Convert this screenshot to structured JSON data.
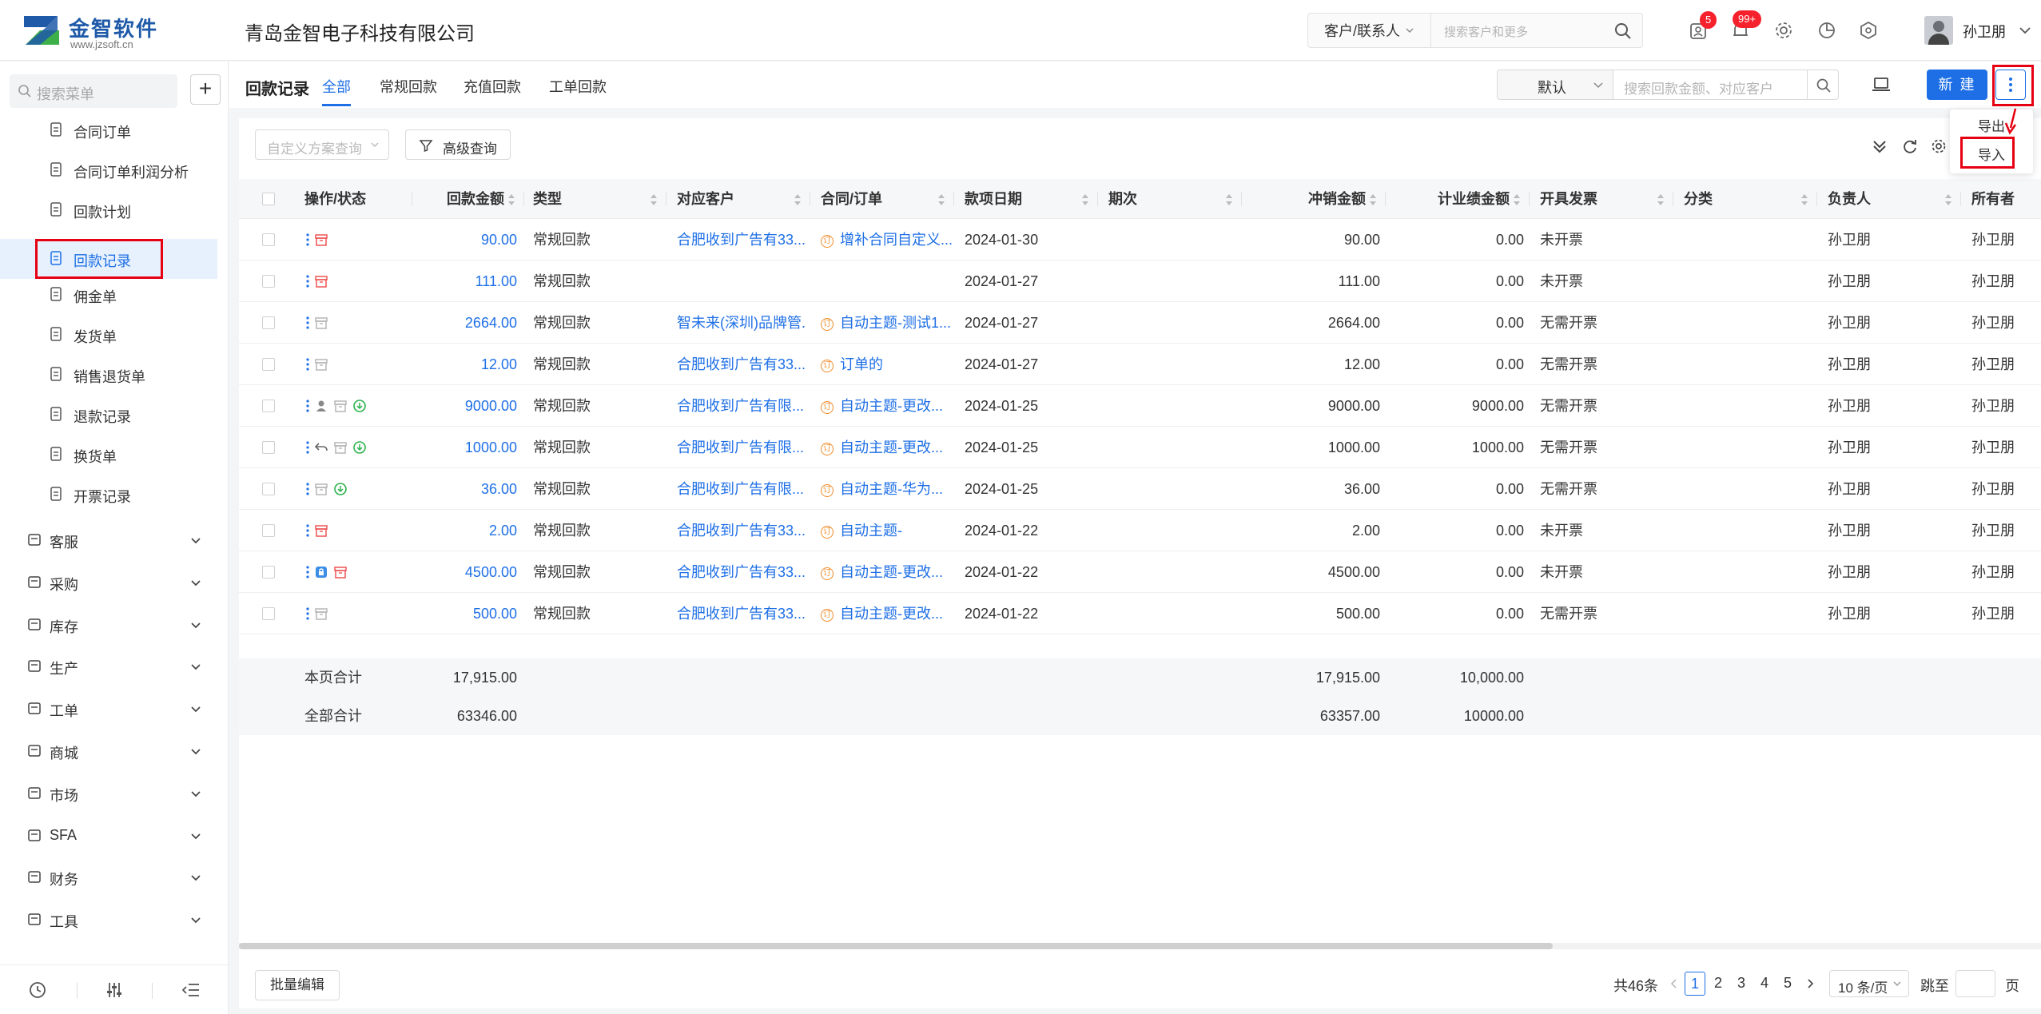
{
  "header": {
    "brand": "金智软件",
    "brand_url": "www.jzsoft.cn",
    "company": "青岛金智电子科技有限公司",
    "search_scope": "客户/联系人",
    "search_placeholder": "搜索客户和更多",
    "todo_badge": "5",
    "notice_badge": "99+",
    "user_name": "孙卫朋"
  },
  "sidebar": {
    "search_placeholder": "搜索菜单",
    "add_label": "+",
    "sub_items": [
      {
        "label": "合同订单",
        "icon": "contract-icon"
      },
      {
        "label": "合同订单利润分析",
        "icon": "analysis-icon"
      },
      {
        "label": "回款计划",
        "icon": "plan-icon"
      },
      {
        "label": "回款记录",
        "icon": "record-icon",
        "active": true
      },
      {
        "label": "佣金单",
        "icon": "commission-icon"
      },
      {
        "label": "发货单",
        "icon": "delivery-icon"
      },
      {
        "label": "销售退货单",
        "icon": "return-icon"
      },
      {
        "label": "退款记录",
        "icon": "refund-icon"
      },
      {
        "label": "换货单",
        "icon": "exchange-icon"
      },
      {
        "label": "开票记录",
        "icon": "invoice-icon"
      }
    ],
    "groups": [
      {
        "label": "客服",
        "icon": "service-icon"
      },
      {
        "label": "采购",
        "icon": "purchase-icon"
      },
      {
        "label": "库存",
        "icon": "warehouse-icon"
      },
      {
        "label": "生产",
        "icon": "production-icon"
      },
      {
        "label": "工单",
        "icon": "workorder-icon"
      },
      {
        "label": "商城",
        "icon": "mall-icon"
      },
      {
        "label": "市场",
        "icon": "market-icon"
      },
      {
        "label": "SFA",
        "icon": "sfa-icon"
      },
      {
        "label": "财务",
        "icon": "finance-icon"
      },
      {
        "label": "工具",
        "icon": "tools-icon"
      }
    ]
  },
  "toolbar": {
    "page_title": "回款记录",
    "tabs": [
      "全部",
      "常规回款",
      "充值回款",
      "工单回款"
    ],
    "active_tab": "全部",
    "view_select": "默认",
    "search_placeholder": "搜索回款金额、对应客户",
    "new_label": "新 建",
    "menu_items": [
      "导出",
      "导入"
    ]
  },
  "filters": {
    "scheme_placeholder": "自定义方案查询",
    "advanced_label": "高级查询"
  },
  "table": {
    "columns": [
      "操作/状态",
      "回款金额",
      "类型",
      "对应客户",
      "合同/订单",
      "款项日期",
      "期次",
      "冲销金额",
      "计业绩金额",
      "开具发票",
      "分类",
      "负责人",
      "所有者"
    ],
    "rows": [
      {
        "amount": "90.00",
        "type": "常规回款",
        "customer": "合肥收到广告有33...",
        "order": "增补合同自定义...",
        "date": "2024-01-30",
        "writeoff": "90.00",
        "perf": "0.00",
        "invoice": "未开票",
        "owner": "孙卫朋",
        "holder": "孙卫朋"
      },
      {
        "amount": "111.00",
        "type": "常规回款",
        "customer": "",
        "order": "",
        "date": "2024-01-27",
        "writeoff": "111.00",
        "perf": "0.00",
        "invoice": "未开票",
        "owner": "孙卫朋",
        "holder": "孙卫朋"
      },
      {
        "amount": "2664.00",
        "type": "常规回款",
        "customer": "智未来(深圳)品牌管...",
        "order": "自动主题-测试1...",
        "date": "2024-01-27",
        "writeoff": "2664.00",
        "perf": "0.00",
        "invoice": "无需开票",
        "owner": "孙卫朋",
        "holder": "孙卫朋"
      },
      {
        "amount": "12.00",
        "type": "常规回款",
        "customer": "合肥收到广告有33...",
        "order": "订单的",
        "date": "2024-01-27",
        "writeoff": "12.00",
        "perf": "0.00",
        "invoice": "无需开票",
        "owner": "孙卫朋",
        "holder": "孙卫朋"
      },
      {
        "amount": "9000.00",
        "type": "常规回款",
        "customer": "合肥收到广告有限...",
        "order": "自动主题-更改...",
        "date": "2024-01-25",
        "writeoff": "9000.00",
        "perf": "9000.00",
        "invoice": "无需开票",
        "owner": "孙卫朋",
        "holder": "孙卫朋"
      },
      {
        "amount": "1000.00",
        "type": "常规回款",
        "customer": "合肥收到广告有限...",
        "order": "自动主题-更改...",
        "date": "2024-01-25",
        "writeoff": "1000.00",
        "perf": "1000.00",
        "invoice": "无需开票",
        "owner": "孙卫朋",
        "holder": "孙卫朋"
      },
      {
        "amount": "36.00",
        "type": "常规回款",
        "customer": "合肥收到广告有限...",
        "order": "自动主题-华为...",
        "date": "2024-01-25",
        "writeoff": "36.00",
        "perf": "0.00",
        "invoice": "无需开票",
        "owner": "孙卫朋",
        "holder": "孙卫朋"
      },
      {
        "amount": "2.00",
        "type": "常规回款",
        "customer": "合肥收到广告有33...",
        "order": "自动主题-",
        "date": "2024-01-22",
        "writeoff": "2.00",
        "perf": "0.00",
        "invoice": "未开票",
        "owner": "孙卫朋",
        "holder": "孙卫朋"
      },
      {
        "amount": "4500.00",
        "type": "常规回款",
        "customer": "合肥收到广告有33...",
        "order": "自动主题-更改...",
        "date": "2024-01-22",
        "writeoff": "4500.00",
        "perf": "0.00",
        "invoice": "未开票",
        "owner": "孙卫朋",
        "holder": "孙卫朋"
      },
      {
        "amount": "500.00",
        "type": "常规回款",
        "customer": "合肥收到广告有33...",
        "order": "自动主题-更改...",
        "date": "2024-01-22",
        "writeoff": "500.00",
        "perf": "0.00",
        "invoice": "无需开票",
        "owner": "孙卫朋",
        "holder": "孙卫朋"
      }
    ],
    "page_total": {
      "label": "本页合计",
      "amount": "17,915.00",
      "writeoff": "17,915.00",
      "perf": "10,000.00"
    },
    "grand_total": {
      "label": "全部合计",
      "amount": "63346.00",
      "writeoff": "63357.00",
      "perf": "10000.00"
    }
  },
  "footer": {
    "bulk_edit": "批量编辑",
    "total_text": "共46条",
    "pages": [
      "1",
      "2",
      "3",
      "4",
      "5"
    ],
    "current_page": "1",
    "page_size": "10 条/页",
    "jump_label": "跳至",
    "page_suffix": "页"
  },
  "colors": {
    "accent": "#1e6fe6",
    "highlight_box": "#e60012",
    "badge": "#f5222d",
    "order_icon": "#f08c2a"
  }
}
